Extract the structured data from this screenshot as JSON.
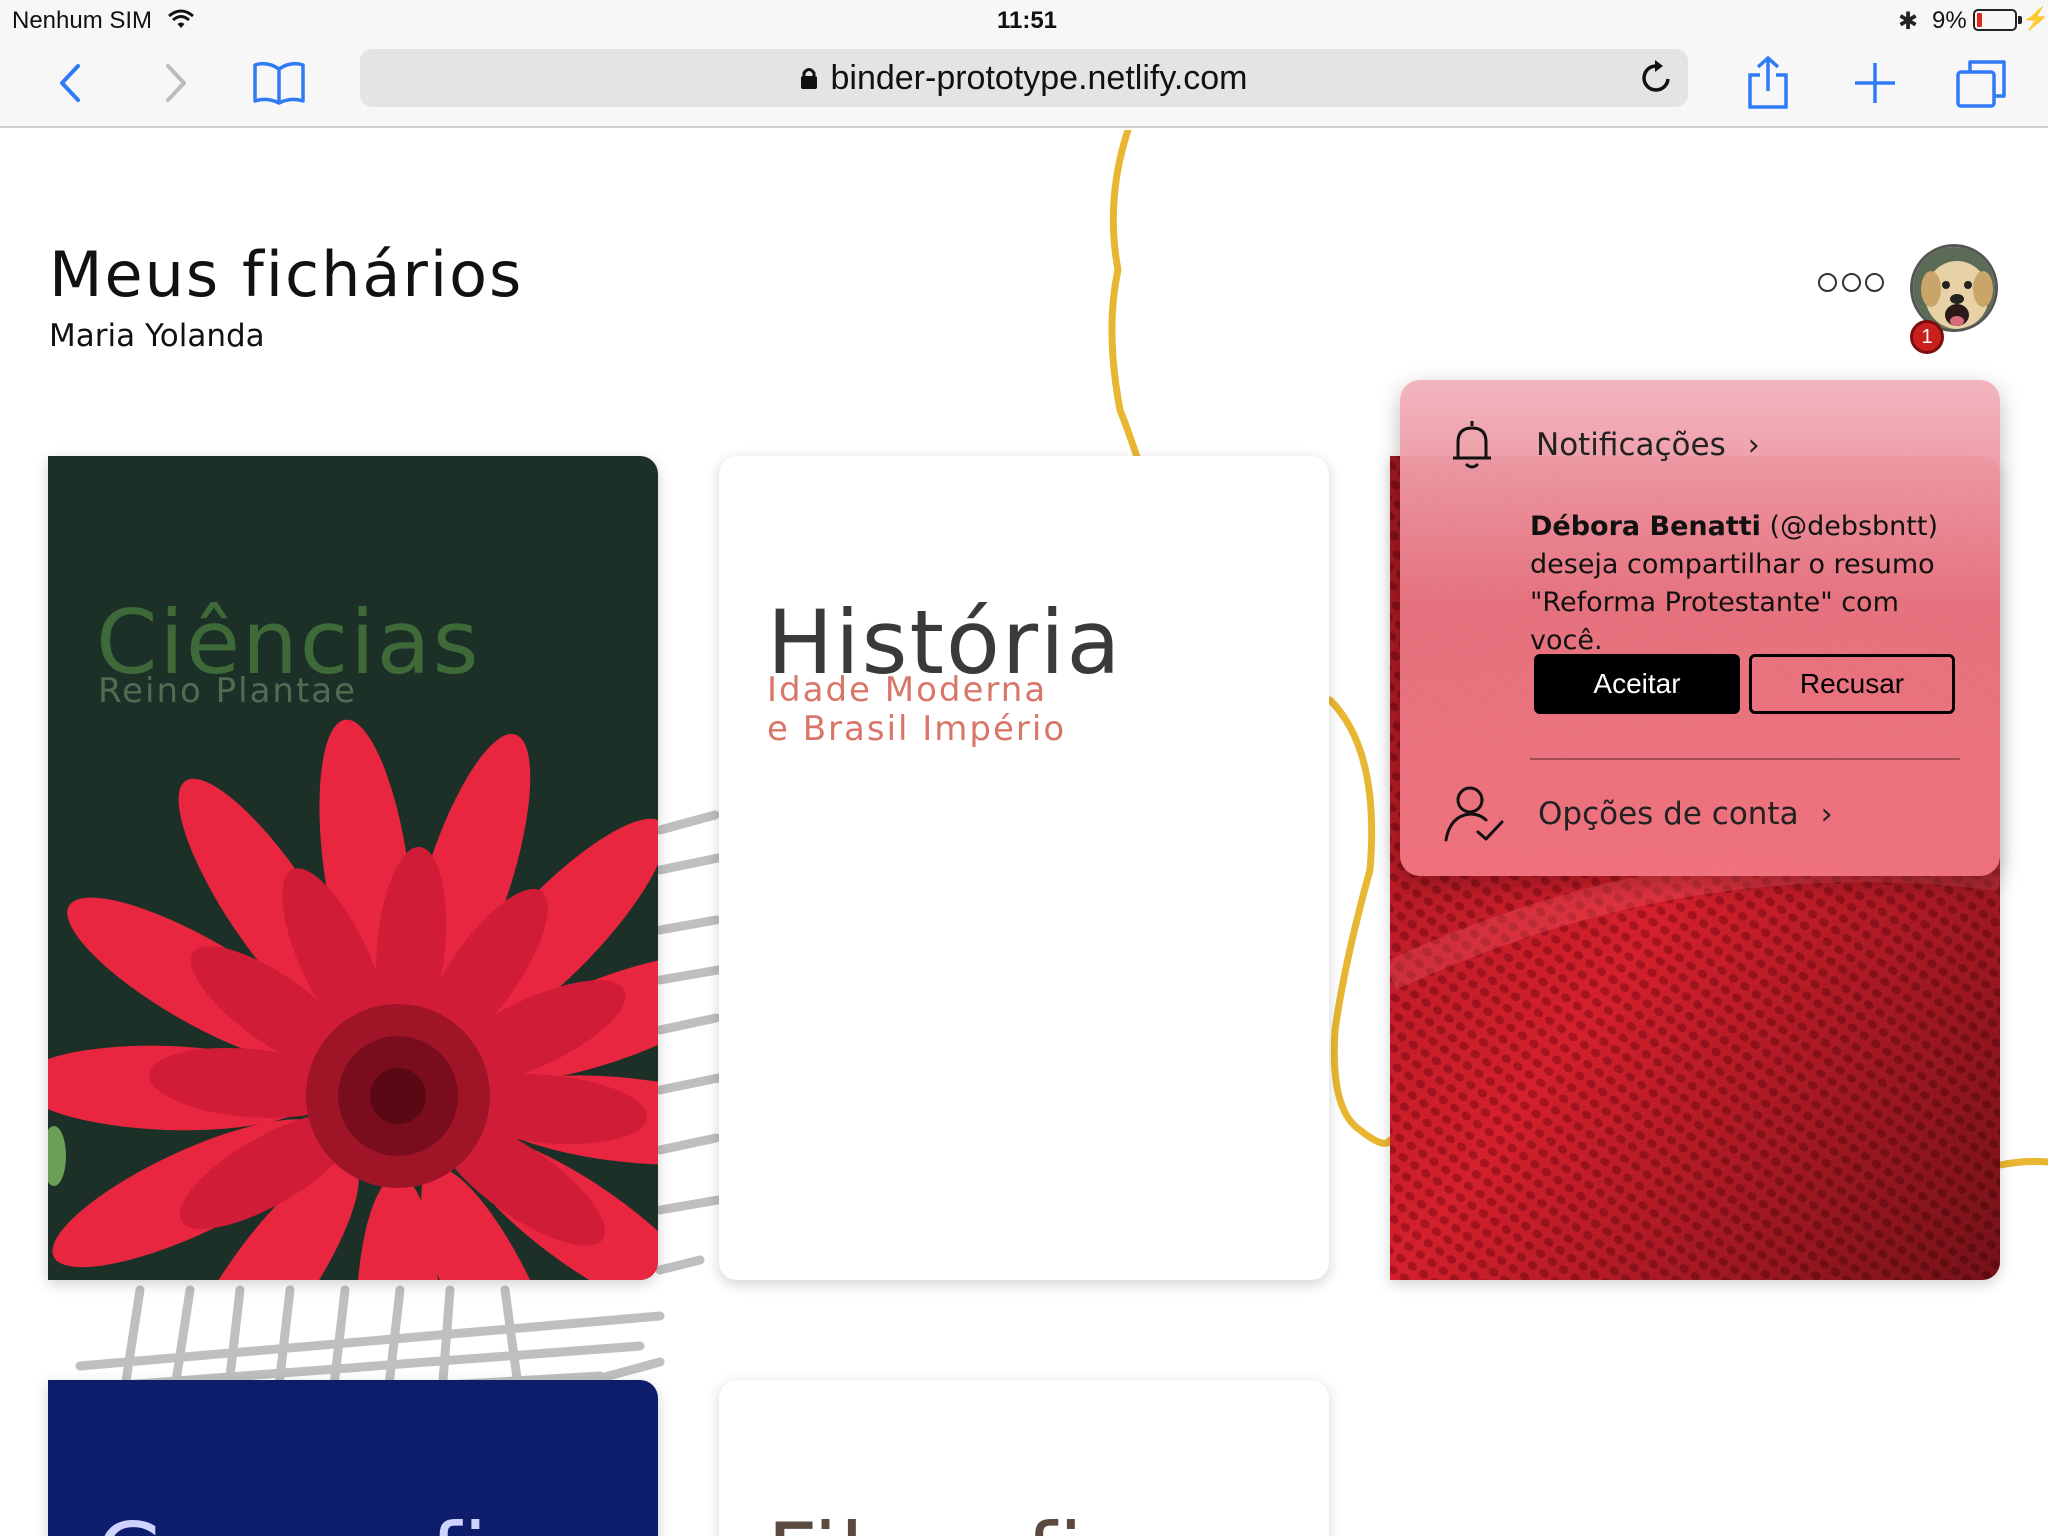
{
  "status_bar": {
    "carrier": "Nenhum SIM",
    "time": "11:51",
    "battery_percent": "9%",
    "battery_level": 0.09
  },
  "browser": {
    "url": "binder-prototype.netlify.com",
    "icons": [
      "back-icon",
      "forward-icon",
      "bookmarks-icon",
      "lock-icon",
      "reload-icon",
      "share-icon",
      "new-tab-icon",
      "tabs-icon"
    ]
  },
  "header": {
    "title": "Meus fichários",
    "user_name": "Maria Yolanda",
    "notification_count": "1"
  },
  "binders": [
    {
      "title": "Ciências",
      "subtitle": "Reino Plantae",
      "color": "#1c3027"
    },
    {
      "title": "História",
      "subtitle_line1": "Idade Moderna",
      "subtitle_line2": "e Brasil Império",
      "color": "#ffffff"
    },
    {
      "title": "",
      "color": "#c0202a"
    },
    {
      "title": "Geografia",
      "color": "#0e1d6b"
    },
    {
      "title": "Filosofia",
      "color": "#ffffff"
    }
  ],
  "popover": {
    "notifications_label": "Notificações",
    "notification": {
      "sender_name": "Débora Benatti",
      "sender_handle": "(@debsbntt)",
      "message_line1": "deseja compartilhar o resumo",
      "message_line2": "\"Reforma Protestante\" com você."
    },
    "accept_label": "Aceitar",
    "refuse_label": "Recusar",
    "account_label": "Opções de conta"
  },
  "colors": {
    "accent_blue": "#2f7bf6",
    "badge_red": "#c8201c",
    "popover_pink": "#ea7a86"
  }
}
